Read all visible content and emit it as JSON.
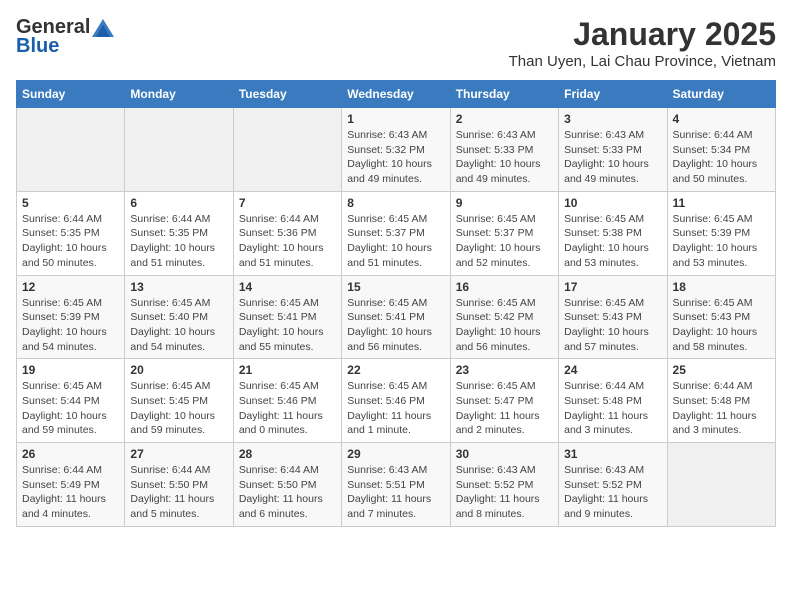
{
  "logo": {
    "general": "General",
    "blue": "Blue"
  },
  "title": "January 2025",
  "subtitle": "Than Uyen, Lai Chau Province, Vietnam",
  "days_of_week": [
    "Sunday",
    "Monday",
    "Tuesday",
    "Wednesday",
    "Thursday",
    "Friday",
    "Saturday"
  ],
  "weeks": [
    [
      {
        "day": "",
        "info": ""
      },
      {
        "day": "",
        "info": ""
      },
      {
        "day": "",
        "info": ""
      },
      {
        "day": "1",
        "info": "Sunrise: 6:43 AM\nSunset: 5:32 PM\nDaylight: 10 hours\nand 49 minutes."
      },
      {
        "day": "2",
        "info": "Sunrise: 6:43 AM\nSunset: 5:33 PM\nDaylight: 10 hours\nand 49 minutes."
      },
      {
        "day": "3",
        "info": "Sunrise: 6:43 AM\nSunset: 5:33 PM\nDaylight: 10 hours\nand 49 minutes."
      },
      {
        "day": "4",
        "info": "Sunrise: 6:44 AM\nSunset: 5:34 PM\nDaylight: 10 hours\nand 50 minutes."
      }
    ],
    [
      {
        "day": "5",
        "info": "Sunrise: 6:44 AM\nSunset: 5:35 PM\nDaylight: 10 hours\nand 50 minutes."
      },
      {
        "day": "6",
        "info": "Sunrise: 6:44 AM\nSunset: 5:35 PM\nDaylight: 10 hours\nand 51 minutes."
      },
      {
        "day": "7",
        "info": "Sunrise: 6:44 AM\nSunset: 5:36 PM\nDaylight: 10 hours\nand 51 minutes."
      },
      {
        "day": "8",
        "info": "Sunrise: 6:45 AM\nSunset: 5:37 PM\nDaylight: 10 hours\nand 51 minutes."
      },
      {
        "day": "9",
        "info": "Sunrise: 6:45 AM\nSunset: 5:37 PM\nDaylight: 10 hours\nand 52 minutes."
      },
      {
        "day": "10",
        "info": "Sunrise: 6:45 AM\nSunset: 5:38 PM\nDaylight: 10 hours\nand 53 minutes."
      },
      {
        "day": "11",
        "info": "Sunrise: 6:45 AM\nSunset: 5:39 PM\nDaylight: 10 hours\nand 53 minutes."
      }
    ],
    [
      {
        "day": "12",
        "info": "Sunrise: 6:45 AM\nSunset: 5:39 PM\nDaylight: 10 hours\nand 54 minutes."
      },
      {
        "day": "13",
        "info": "Sunrise: 6:45 AM\nSunset: 5:40 PM\nDaylight: 10 hours\nand 54 minutes."
      },
      {
        "day": "14",
        "info": "Sunrise: 6:45 AM\nSunset: 5:41 PM\nDaylight: 10 hours\nand 55 minutes."
      },
      {
        "day": "15",
        "info": "Sunrise: 6:45 AM\nSunset: 5:41 PM\nDaylight: 10 hours\nand 56 minutes."
      },
      {
        "day": "16",
        "info": "Sunrise: 6:45 AM\nSunset: 5:42 PM\nDaylight: 10 hours\nand 56 minutes."
      },
      {
        "day": "17",
        "info": "Sunrise: 6:45 AM\nSunset: 5:43 PM\nDaylight: 10 hours\nand 57 minutes."
      },
      {
        "day": "18",
        "info": "Sunrise: 6:45 AM\nSunset: 5:43 PM\nDaylight: 10 hours\nand 58 minutes."
      }
    ],
    [
      {
        "day": "19",
        "info": "Sunrise: 6:45 AM\nSunset: 5:44 PM\nDaylight: 10 hours\nand 59 minutes."
      },
      {
        "day": "20",
        "info": "Sunrise: 6:45 AM\nSunset: 5:45 PM\nDaylight: 10 hours\nand 59 minutes."
      },
      {
        "day": "21",
        "info": "Sunrise: 6:45 AM\nSunset: 5:46 PM\nDaylight: 11 hours\nand 0 minutes."
      },
      {
        "day": "22",
        "info": "Sunrise: 6:45 AM\nSunset: 5:46 PM\nDaylight: 11 hours\nand 1 minute."
      },
      {
        "day": "23",
        "info": "Sunrise: 6:45 AM\nSunset: 5:47 PM\nDaylight: 11 hours\nand 2 minutes."
      },
      {
        "day": "24",
        "info": "Sunrise: 6:44 AM\nSunset: 5:48 PM\nDaylight: 11 hours\nand 3 minutes."
      },
      {
        "day": "25",
        "info": "Sunrise: 6:44 AM\nSunset: 5:48 PM\nDaylight: 11 hours\nand 3 minutes."
      }
    ],
    [
      {
        "day": "26",
        "info": "Sunrise: 6:44 AM\nSunset: 5:49 PM\nDaylight: 11 hours\nand 4 minutes."
      },
      {
        "day": "27",
        "info": "Sunrise: 6:44 AM\nSunset: 5:50 PM\nDaylight: 11 hours\nand 5 minutes."
      },
      {
        "day": "28",
        "info": "Sunrise: 6:44 AM\nSunset: 5:50 PM\nDaylight: 11 hours\nand 6 minutes."
      },
      {
        "day": "29",
        "info": "Sunrise: 6:43 AM\nSunset: 5:51 PM\nDaylight: 11 hours\nand 7 minutes."
      },
      {
        "day": "30",
        "info": "Sunrise: 6:43 AM\nSunset: 5:52 PM\nDaylight: 11 hours\nand 8 minutes."
      },
      {
        "day": "31",
        "info": "Sunrise: 6:43 AM\nSunset: 5:52 PM\nDaylight: 11 hours\nand 9 minutes."
      },
      {
        "day": "",
        "info": ""
      }
    ]
  ]
}
